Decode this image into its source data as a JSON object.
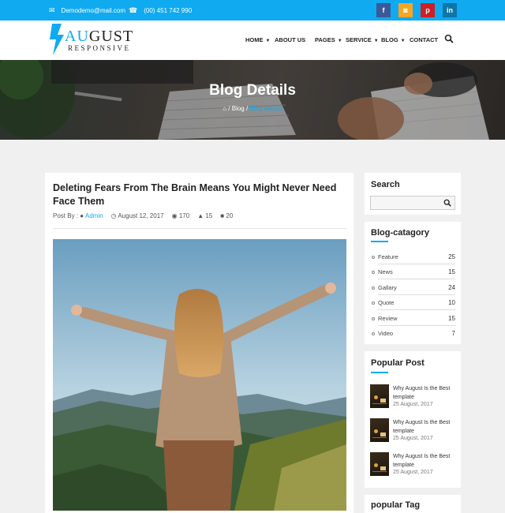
{
  "topbar": {
    "email": "Demodemo@mail.com",
    "phone": "(00) 451 742 990",
    "social": [
      {
        "icon": "facebook-icon",
        "glyph": "f"
      },
      {
        "icon": "rss-icon",
        "glyph": "◙"
      },
      {
        "icon": "pinterest-icon",
        "glyph": "p"
      },
      {
        "icon": "linkedin-icon",
        "glyph": "in"
      }
    ]
  },
  "logo": {
    "accent": "AU",
    "main": "GUST",
    "sub": "RESPONSIVE"
  },
  "nav": {
    "home": "HOME",
    "about": "ABOUT US",
    "pages": "PAGES",
    "service": "SERVICE",
    "blog": "BLOG",
    "contact": "CONTACT"
  },
  "hero": {
    "title": "Blog Details",
    "crumb_home_icon": "home-icon",
    "crumb_sep": "/",
    "crumb_blog": "Blog",
    "crumb_current": "Blog details"
  },
  "post": {
    "title": "Deleting Fears From The Brain Means You Might Never Need Face Them",
    "meta": {
      "posted_by_label": "Post By :",
      "author": "Admin",
      "date": "August 12, 2017",
      "views": "170",
      "likes": "15",
      "comments": "20"
    }
  },
  "sidebar": {
    "search": {
      "title": "Search",
      "placeholder": ""
    },
    "categories": {
      "title": "Blog-catagory",
      "items": [
        {
          "name": "Feature",
          "count": "25"
        },
        {
          "name": "News",
          "count": "15"
        },
        {
          "name": "Gallary",
          "count": "24"
        },
        {
          "name": "Quote",
          "count": "10"
        },
        {
          "name": "Review",
          "count": "15"
        },
        {
          "name": "Video",
          "count": "7"
        }
      ]
    },
    "popular": {
      "title": "Popular Post",
      "items": [
        {
          "title": "Why August Is the Best template",
          "date": "25 August, 2017"
        },
        {
          "title": "Why August Is the Best template",
          "date": "25 August, 2017"
        },
        {
          "title": "Why August Is the Best template",
          "date": "25 August, 2017"
        }
      ]
    },
    "tags": {
      "title": "popular Tag"
    }
  },
  "colors": {
    "accent": "#10aaf0"
  }
}
